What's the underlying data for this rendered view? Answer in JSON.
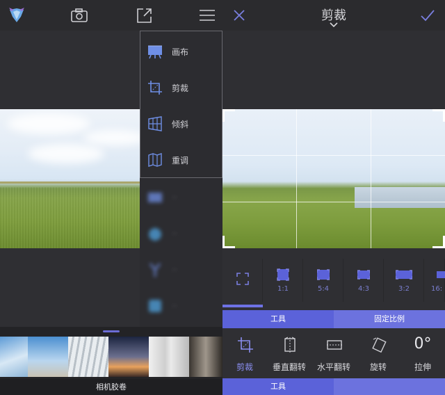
{
  "left_panel": {
    "menu": {
      "items": [
        {
          "label": "画布",
          "icon": "canvas-icon"
        },
        {
          "label": "剪裁",
          "icon": "crop-icon"
        },
        {
          "label": "倾斜",
          "icon": "perspective-icon"
        },
        {
          "label": "重调",
          "icon": "reshape-icon"
        }
      ],
      "blurred_items": [
        "picture-icon",
        "filter-icon",
        "tools-icon",
        "art-icon"
      ]
    },
    "filmstrip": {
      "label": "相机胶卷"
    }
  },
  "right_panel": {
    "title": "剪裁",
    "ratios": [
      {
        "label": "",
        "icon": "free-crop-icon"
      },
      {
        "label": "1:1",
        "icon": "ratio-1-1-icon"
      },
      {
        "label": "5:4",
        "icon": "ratio-5-4-icon"
      },
      {
        "label": "4:3",
        "icon": "ratio-4-3-icon"
      },
      {
        "label": "3:2",
        "icon": "ratio-3-2-icon"
      },
      {
        "label": "16:",
        "icon": "ratio-16-9-icon"
      }
    ],
    "tabs": {
      "tools": "工具",
      "fixed_ratio": "固定比例"
    },
    "tools": [
      {
        "label": "剪裁",
        "icon": "crop-icon",
        "selected": true
      },
      {
        "label": "垂直翻转",
        "icon": "flip-vertical-icon",
        "selected": false
      },
      {
        "label": "水平翻转",
        "icon": "flip-horizontal-icon",
        "selected": false
      },
      {
        "label": "旋转",
        "icon": "rotate-icon",
        "selected": false
      },
      {
        "label": "拉伸",
        "icon": "stretch-icon",
        "selected": false,
        "value": "0°"
      }
    ],
    "bottom_tab": "工具"
  },
  "colors": {
    "accent": "#5b62d9",
    "accent_light": "#6c72de",
    "background": "#2f2f33"
  }
}
